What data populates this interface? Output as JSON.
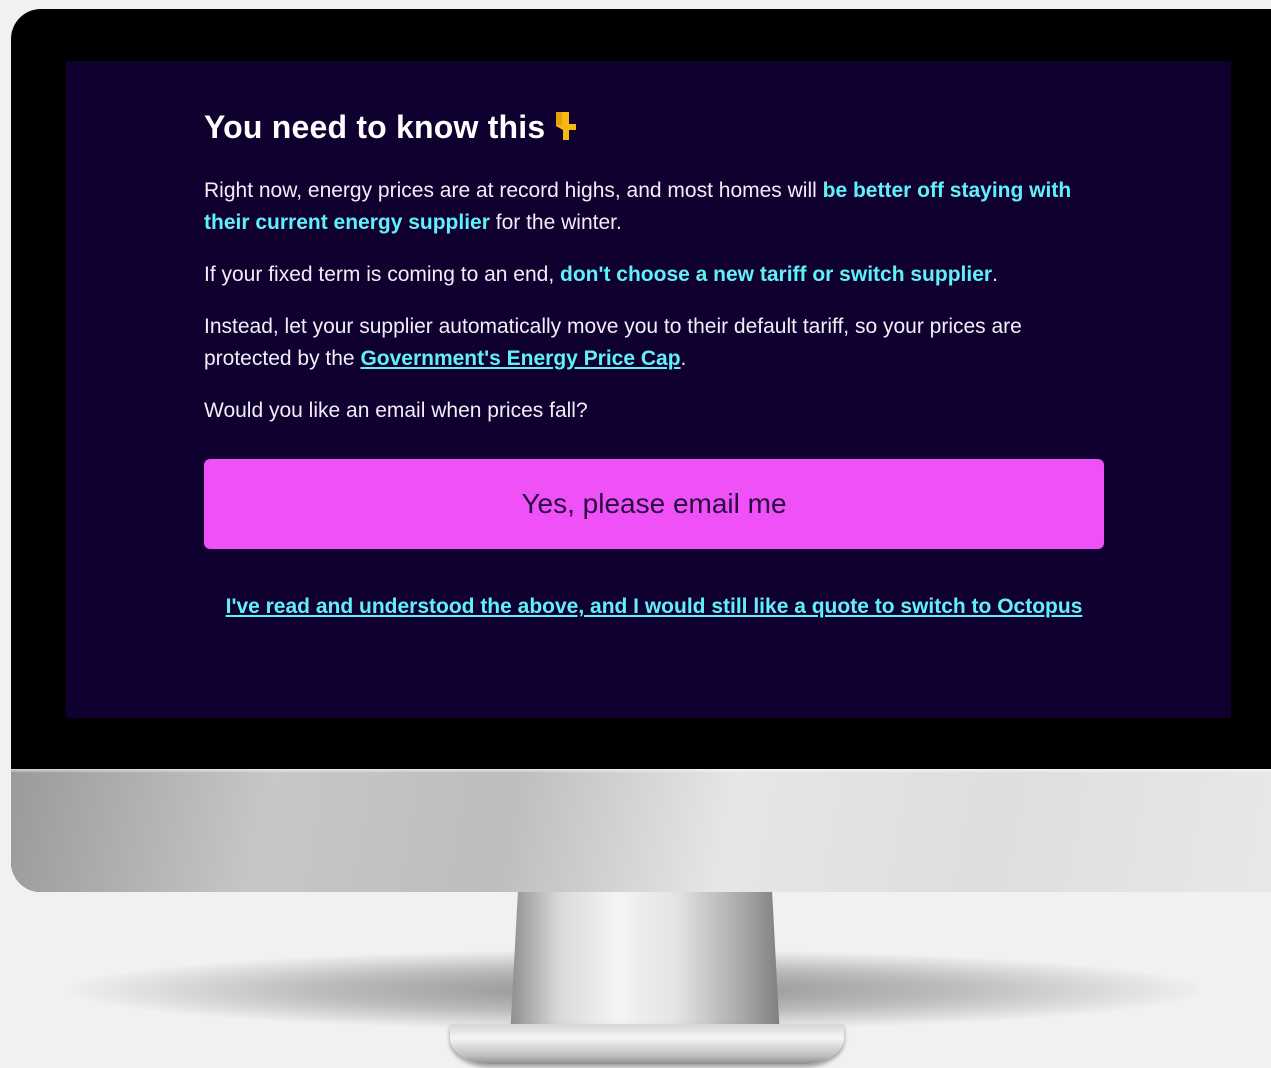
{
  "modal": {
    "title": "You need to know this",
    "title_icon": "pointing-down-hand-icon",
    "paragraph1": {
      "before": "Right now, energy prices are at record highs, and most homes will ",
      "highlight": "be better off staying with their current energy supplier",
      "after": " for the winter."
    },
    "paragraph2": {
      "before": "If your fixed term is coming to an end, ",
      "highlight": "don't choose a new tariff or switch supplier",
      "after": "."
    },
    "paragraph3": {
      "before": "Instead, let your supplier automatically move you to their default tariff, so your prices are protected by the ",
      "link": "Government's Energy Price Cap",
      "after": "."
    },
    "question": "Would you like an email when prices fall?",
    "email_button_label": "Yes, please email me",
    "quote_link_label": "I've read and understood the above, and I would still like a quote to switch to Octopus"
  },
  "colors": {
    "screen_background": "#100030",
    "highlight": "#60f0f8",
    "button": "#f050f8",
    "text": "#f1eef7"
  }
}
